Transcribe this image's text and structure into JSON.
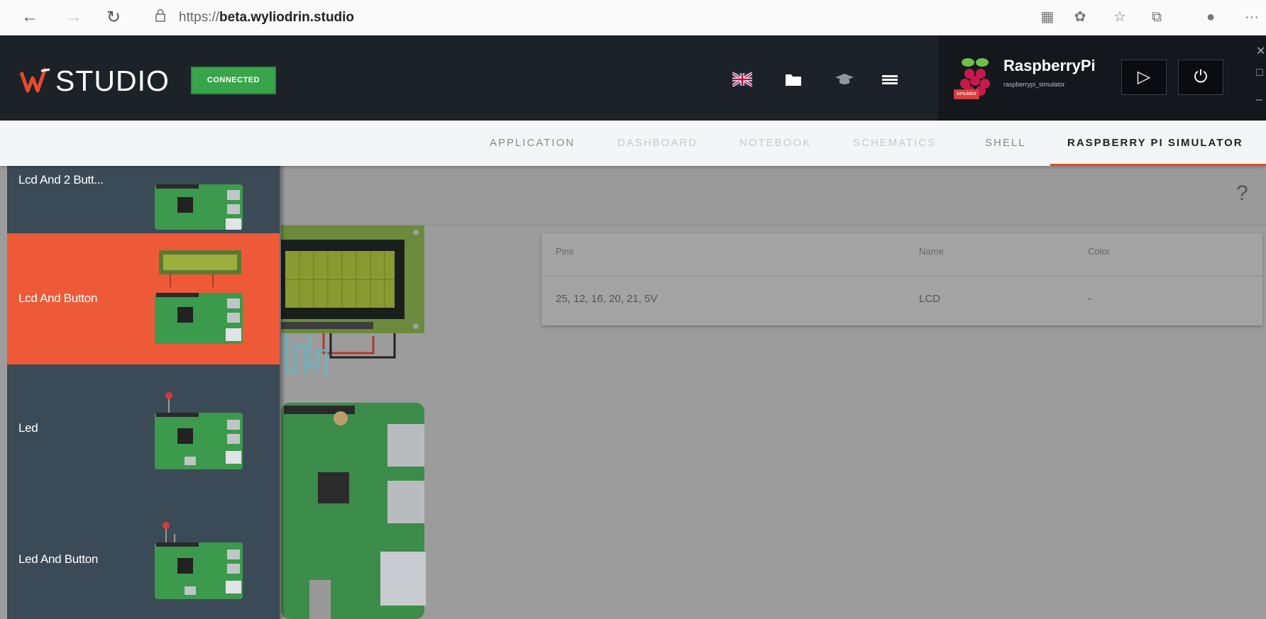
{
  "browser": {
    "url_scheme": "https://",
    "url_host": "beta.wyliodrin.studio",
    "more": "···"
  },
  "header": {
    "logo_text": "STUDIO",
    "status_badge": "CONNECTED",
    "board_name": "RaspberryPi",
    "board_subtitle": "raspberrypi_simulator",
    "board_tag": "simulator",
    "play_label": "▷",
    "power_label": "⏻"
  },
  "tabs": [
    {
      "label": "APPLICATION"
    },
    {
      "label": "DASHBOARD"
    },
    {
      "label": "NOTEBOOK"
    },
    {
      "label": "SCHEMATICS"
    },
    {
      "label": "SHELL"
    },
    {
      "label": "RASPBERRY PI SIMULATOR"
    }
  ],
  "sidebar": {
    "items": [
      {
        "label": "Lcd And 2 Butt..."
      },
      {
        "label": "Lcd And Button"
      },
      {
        "label": "Led"
      },
      {
        "label": "Led And Button"
      }
    ],
    "selected": "Lcd And Button"
  },
  "pin_table": {
    "headers": [
      "Pins",
      "Name",
      "Color"
    ],
    "rows": [
      {
        "pins": "25, 12, 16, 20, 21, 5V",
        "name": "LCD",
        "color": "-"
      }
    ]
  },
  "help_label": "?",
  "colors": {
    "accent": "#e64a2e",
    "header_bg": "#1c2228",
    "sidebar_bg": "#3a4a56",
    "active_item": "#ee5a37",
    "connected": "#39a54a"
  }
}
